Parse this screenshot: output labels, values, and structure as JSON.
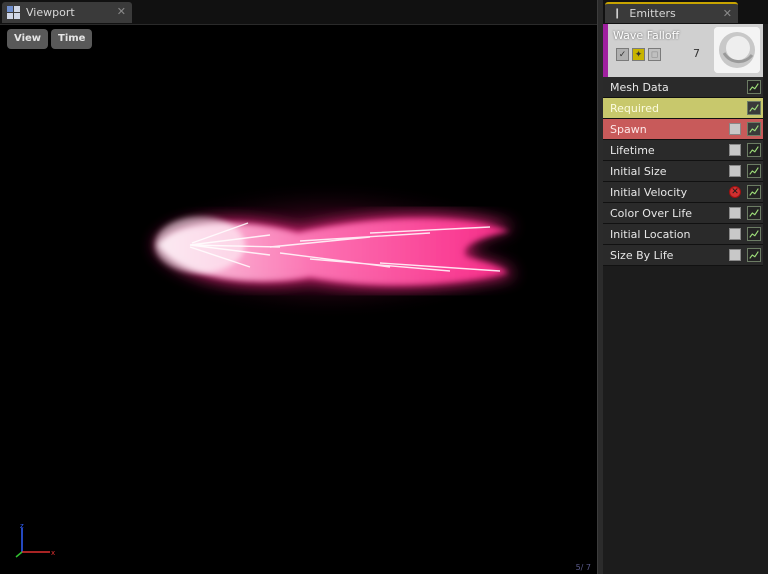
{
  "viewport": {
    "tab_label": "Viewport",
    "tab_icon": "viewport-grid-icon",
    "view_button": "View",
    "time_button": "Time",
    "stats": "5/  7"
  },
  "emitters": {
    "tab_label": "Emitters",
    "tab_icon": "emitters-icon",
    "emitter": {
      "name": "Wave Falloff",
      "particle_count": "7",
      "accent_color": "#a020a0"
    },
    "modules": [
      {
        "label": "Mesh Data",
        "type": "normal",
        "checkbox": "none"
      },
      {
        "label": "Required",
        "type": "required",
        "checkbox": "none"
      },
      {
        "label": "Spawn",
        "type": "spawn",
        "checkbox": "on"
      },
      {
        "label": "Lifetime",
        "type": "normal",
        "checkbox": "on"
      },
      {
        "label": "Initial Size",
        "type": "normal",
        "checkbox": "on"
      },
      {
        "label": "Initial Velocity",
        "type": "normal",
        "checkbox": "off"
      },
      {
        "label": "Color Over Life",
        "type": "normal",
        "checkbox": "on"
      },
      {
        "label": "Initial Location",
        "type": "normal",
        "checkbox": "on"
      },
      {
        "label": "Size By Life",
        "type": "normal",
        "checkbox": "on"
      }
    ]
  },
  "colors": {
    "required": "#c8c86c",
    "spawn": "#c85a5a",
    "particle_glow": "#ff3c9c"
  }
}
